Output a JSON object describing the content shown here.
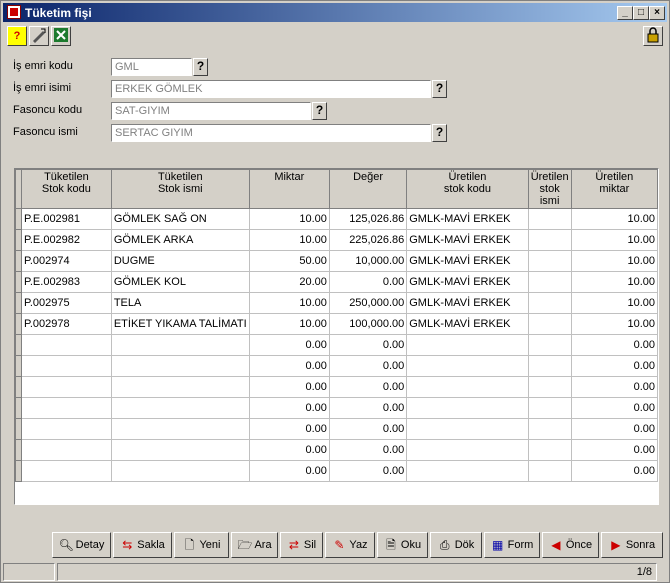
{
  "window": {
    "title": "Tüketim fişi"
  },
  "form": {
    "is_emri_kodu": {
      "label": "İş emri kodu",
      "value": "GML"
    },
    "is_emri_ismi": {
      "label": "İş emri isimi",
      "value": "ERKEK GÖMLEK"
    },
    "fasoncu_kodu": {
      "label": "Fasoncu kodu",
      "value": "SAT-GIYIM"
    },
    "fasoncu_ismi": {
      "label": "Fasoncu ismi",
      "value": "SERTAC GIYIM"
    },
    "lookup_label": "?"
  },
  "grid": {
    "headers": [
      "Tüketilen\nStok kodu",
      "Tüketilen\nStok ismi",
      "Miktar",
      "Değer",
      "Üretilen\nstok kodu",
      "Üretilen\nstok ismi",
      "Üretilen\nmiktar"
    ],
    "rows": [
      [
        "P.E.002981",
        "GÖMLEK SAĞ ON",
        "10.00",
        "125,026.86",
        "GMLK-MAVİ ERKEK",
        "",
        "10.00"
      ],
      [
        "P.E.002982",
        "GÖMLEK ARKA",
        "10.00",
        "225,026.86",
        "GMLK-MAVİ ERKEK",
        "",
        "10.00"
      ],
      [
        "P.002974",
        "DUGME",
        "50.00",
        "10,000.00",
        "GMLK-MAVİ ERKEK",
        "",
        "10.00"
      ],
      [
        "P.E.002983",
        "GÖMLEK KOL",
        "20.00",
        "0.00",
        "GMLK-MAVİ ERKEK",
        "",
        "10.00"
      ],
      [
        "P.002975",
        "TELA",
        "10.00",
        "250,000.00",
        "GMLK-MAVİ ERKEK",
        "",
        "10.00"
      ],
      [
        "P.002978",
        "ETİKET YIKAMA TALİMATI",
        "10.00",
        "100,000.00",
        "GMLK-MAVİ ERKEK",
        "",
        "10.00"
      ],
      [
        "",
        "",
        "0.00",
        "0.00",
        "",
        "",
        "0.00"
      ],
      [
        "",
        "",
        "0.00",
        "0.00",
        "",
        "",
        "0.00"
      ],
      [
        "",
        "",
        "0.00",
        "0.00",
        "",
        "",
        "0.00"
      ],
      [
        "",
        "",
        "0.00",
        "0.00",
        "",
        "",
        "0.00"
      ],
      [
        "",
        "",
        "0.00",
        "0.00",
        "",
        "",
        "0.00"
      ],
      [
        "",
        "",
        "0.00",
        "0.00",
        "",
        "",
        "0.00"
      ],
      [
        "",
        "",
        "0.00",
        "0.00",
        "",
        "",
        "0.00"
      ]
    ]
  },
  "buttons": {
    "detay": "Detay",
    "sakla": "Sakla",
    "yeni": "Yeni",
    "ara": "Ara",
    "sil": "Sil",
    "yaz": "Yaz",
    "oku": "Oku",
    "dok": "Dök",
    "form": "Form",
    "once": "Önce",
    "sonra": "Sonra"
  },
  "status": {
    "page": "1/8"
  }
}
